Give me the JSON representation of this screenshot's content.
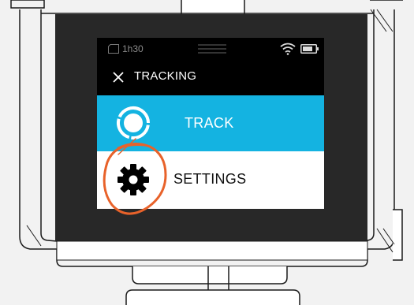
{
  "status_bar": {
    "recording_time": "1h30",
    "sd_card_icon": "sd-card-icon",
    "menu_icon": "menu-lines-icon",
    "wifi_icon": "wifi-icon",
    "battery_icon": "battery-icon"
  },
  "header": {
    "close_icon": "close-icon",
    "title": "TRACKING"
  },
  "menu": {
    "items": [
      {
        "label": "TRACK",
        "icon": "track-target-icon",
        "selected": true
      },
      {
        "label": "SETTINGS",
        "icon": "gear-icon",
        "selected": false
      }
    ]
  },
  "colors": {
    "accent": "#14b3e1",
    "annotation": "#e8622a",
    "screen_bg": "#000000",
    "device_body": "#f2f2f2"
  }
}
